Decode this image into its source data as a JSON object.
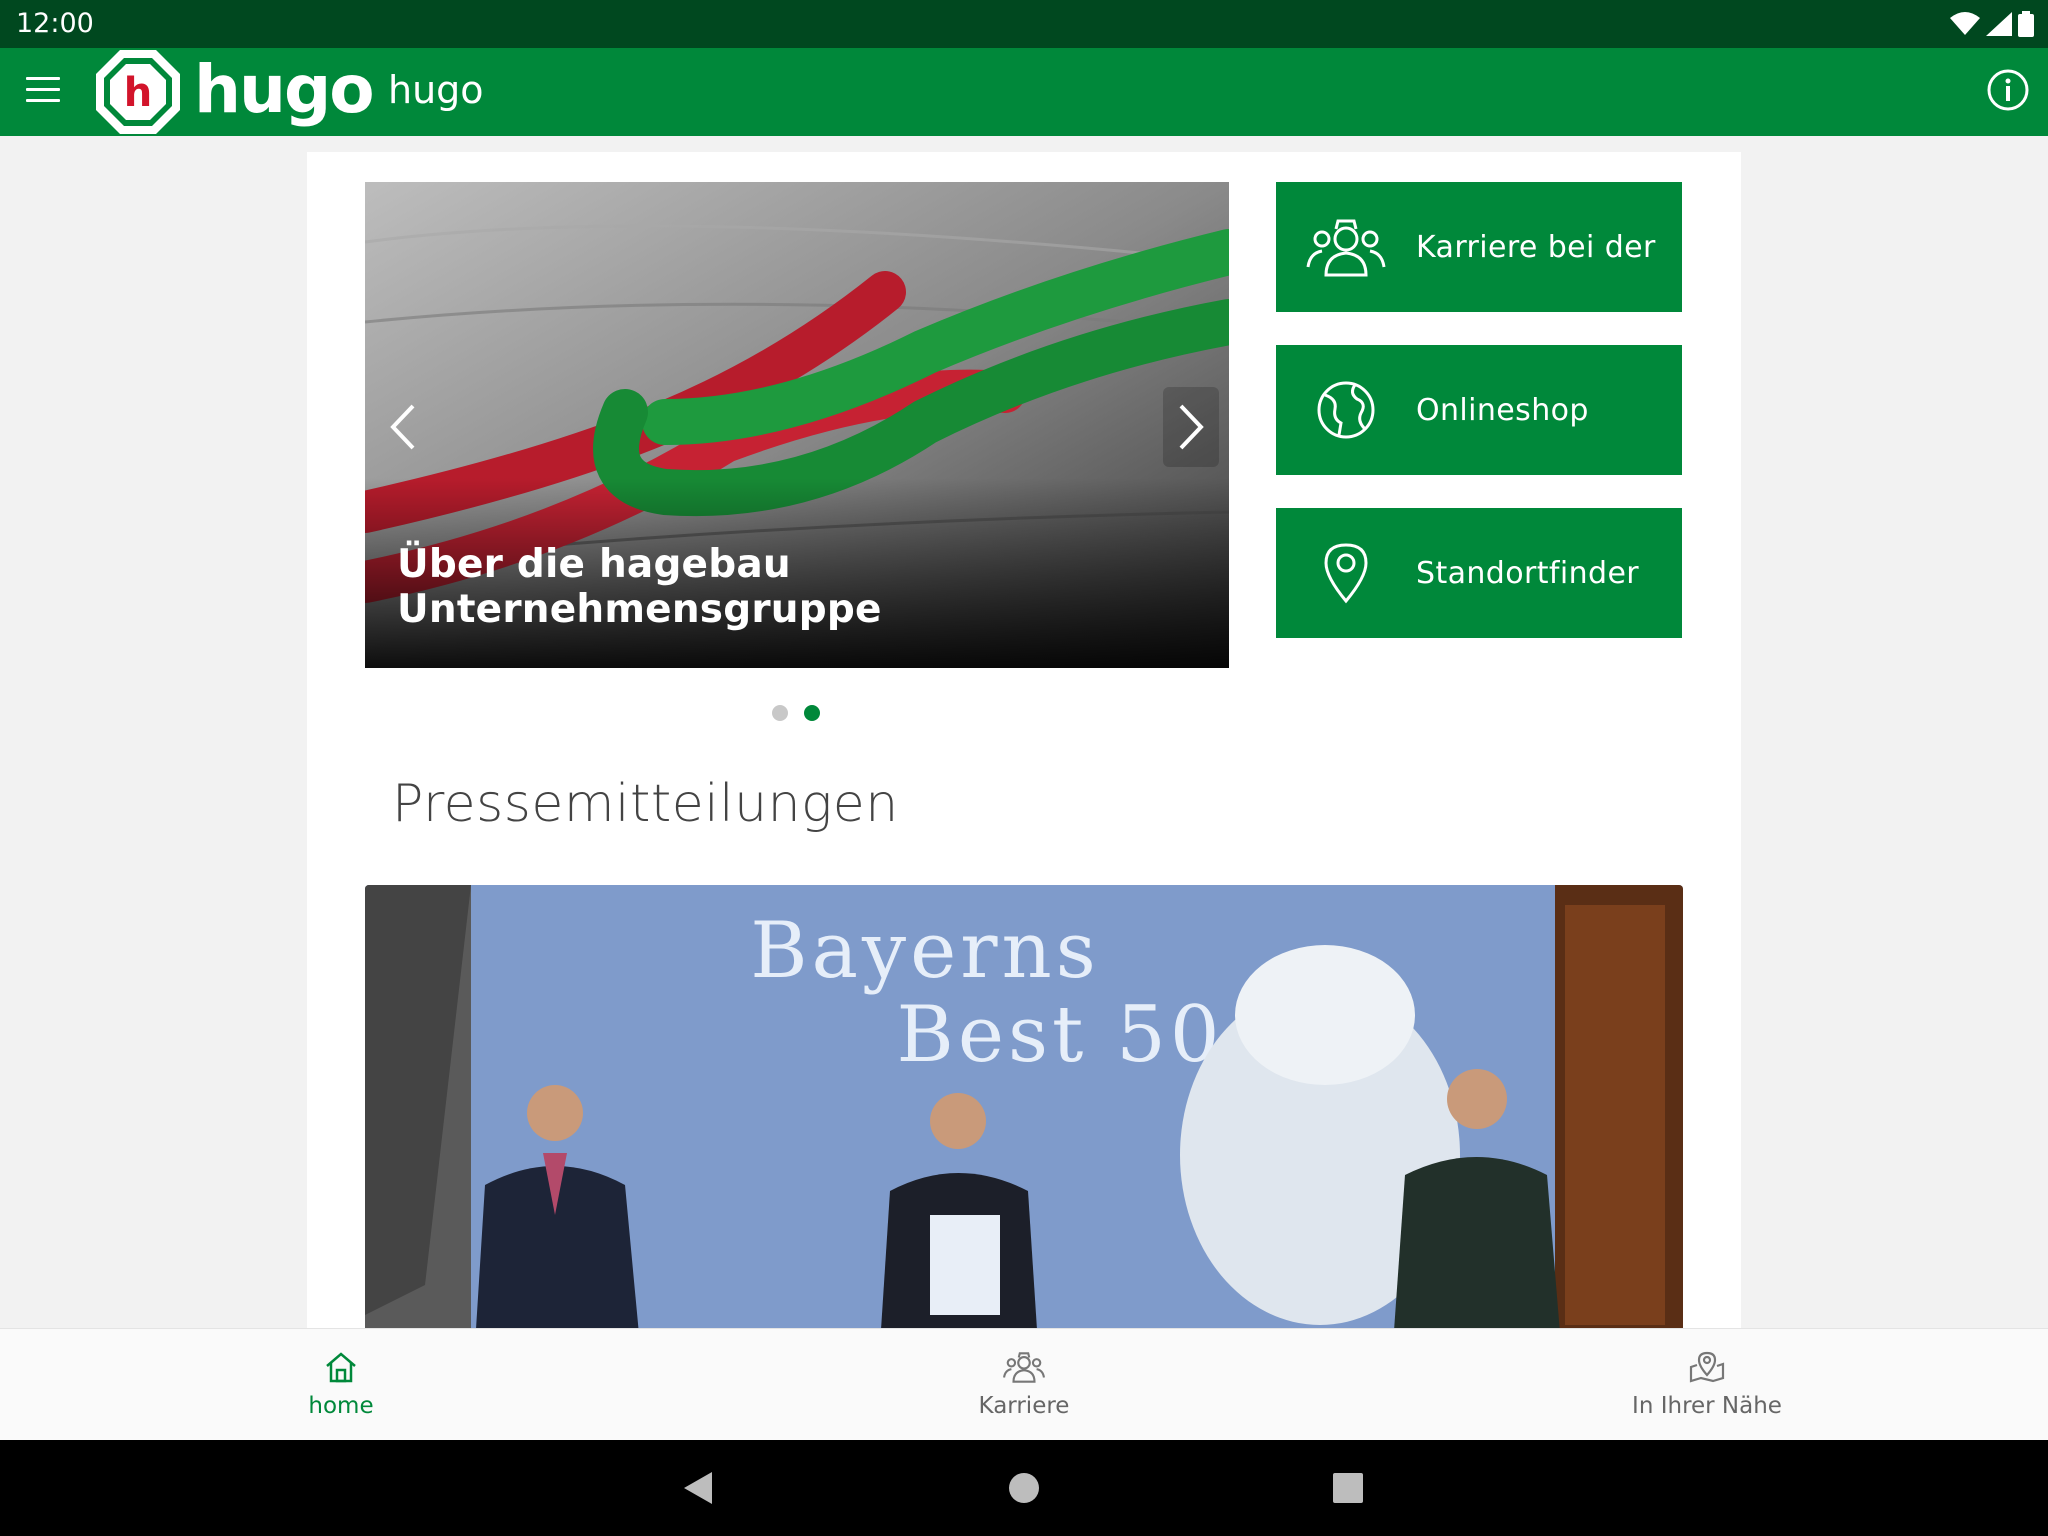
{
  "status_bar": {
    "time": "12:00"
  },
  "app_bar": {
    "logo_text": "hugo",
    "title": "hugo"
  },
  "slider": {
    "caption": "Über die hagebau Unternehmensgruppe",
    "total_slides": 2,
    "active_slide": 2
  },
  "tiles": [
    {
      "label": "Karriere bei der",
      "icon": "people-icon"
    },
    {
      "label": "Onlineshop",
      "icon": "globe-icon"
    },
    {
      "label": "Standortfinder",
      "icon": "location-pin-icon"
    }
  ],
  "press": {
    "section_title": "Pressemitteilungen",
    "image_headline_line1": "Bayerns",
    "image_headline_line2": "Best 50"
  },
  "bottom_nav": [
    {
      "label": "home",
      "icon": "home-icon",
      "active": true
    },
    {
      "label": "Karriere",
      "icon": "people-icon",
      "active": false
    },
    {
      "label": "In Ihrer Nähe",
      "icon": "map-pin-icon",
      "active": false
    }
  ],
  "colors": {
    "brand_green": "#00883a",
    "status_green": "#00481f",
    "logo_red": "#d2142b"
  }
}
